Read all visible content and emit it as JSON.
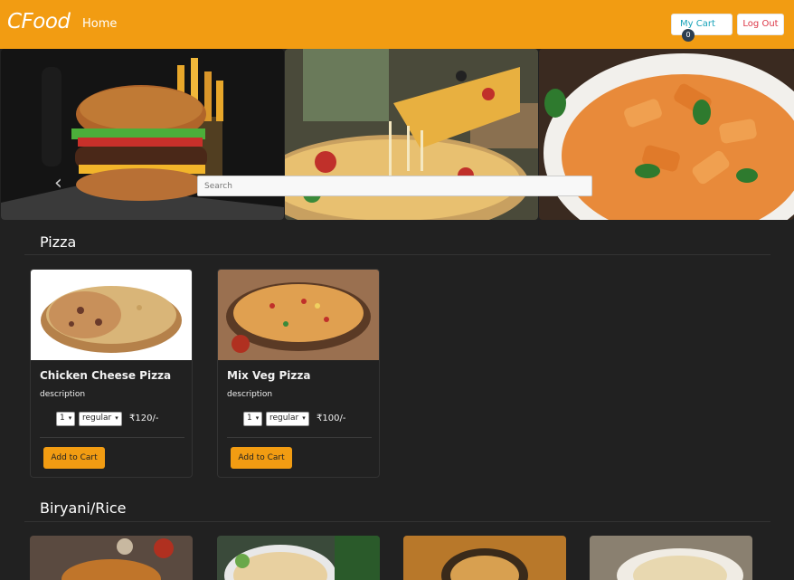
{
  "navbar": {
    "brand": "CFood",
    "home": "Home",
    "cart_label": "My Cart",
    "cart_count": "0",
    "logout": "Log Out"
  },
  "search": {
    "placeholder": "Search"
  },
  "categories": [
    {
      "title": "Pizza",
      "items": [
        {
          "name": "Chicken Cheese Pizza",
          "description": "description",
          "qty": "1",
          "size": "regular",
          "price": "₹120/-",
          "button": "Add to Cart"
        },
        {
          "name": "Mix Veg Pizza",
          "description": "description",
          "qty": "1",
          "size": "regular",
          "price": "₹100/-",
          "button": "Add to Cart"
        }
      ]
    },
    {
      "title": "Biryani/Rice"
    }
  ],
  "colors": {
    "navbar": "#f29c12",
    "background": "#212121",
    "cart_text": "#17a2b8",
    "logout_text": "#dc3545"
  }
}
